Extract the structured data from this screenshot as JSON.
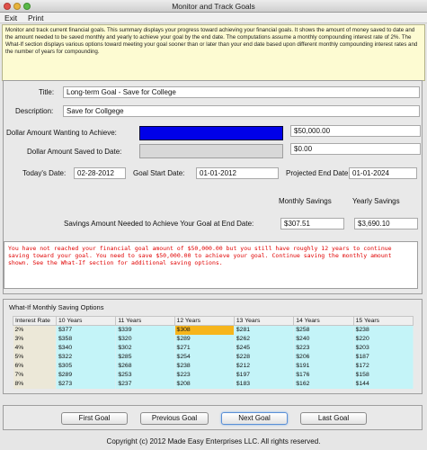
{
  "window": {
    "title": "Monitor and Track Goals"
  },
  "menu": {
    "exit": "Exit",
    "print": "Print"
  },
  "intro_text": "Monitor and track current financial goals. This summary displays your progress toward achieving your financial goals. It shows the amount of money saved to date and the amount needed to be saved monthly and yearly to achieve your goal by the end date. The computations assume a monthly compounding interest rate of 2%. The What-If section displays various options toward meeting your goal sooner than or later than your end date based upon different monthly compounding interest rates and the number of years for compounding.",
  "goal": {
    "title_label": "Title:",
    "title_value": "Long-term Goal - Save for College",
    "description_label": "Description:",
    "description_value": "Save for Collgege",
    "wanting_label": "Dollar Amount Wanting to Achieve:",
    "wanting_value": "$50,000.00",
    "saved_label": "Dollar Amount Saved to Date:",
    "saved_value": "$0.00",
    "saved_progress_percent": 0,
    "todays_date_label": "Today's Date:",
    "todays_date_value": "02-28-2012",
    "start_date_label": "Goal Start Date:",
    "start_date_value": "01-01-2012",
    "end_date_label": "Projected End Date:",
    "end_date_value": "01-01-2024",
    "monthly_header": "Monthly Savings",
    "yearly_header": "Yearly Savings",
    "needed_label": "Savings Amount Needed to Achieve Your Goal at End Date:",
    "monthly_value": "$307.51",
    "yearly_value": "$3,690.10"
  },
  "message": "You have not reached your financial goal amount of $50,000.00 but you still have roughly 12 years to continue saving toward your goal. You need to save $50,000.00 to achieve your goal. Continue saving the monthly amount shown. See the What-If section for additional saving options.",
  "whatif": {
    "title": "What-If Monthly Saving Options",
    "headers": [
      "Interest Rate",
      "10 Years",
      "11 Years",
      "12 Years",
      "13 Years",
      "14 Years",
      "15 Years"
    ],
    "rows": [
      [
        "2%",
        "$377",
        "$339",
        "$308",
        "$281",
        "$258",
        "$238"
      ],
      [
        "3%",
        "$358",
        "$320",
        "$289",
        "$262",
        "$240",
        "$220"
      ],
      [
        "4%",
        "$340",
        "$302",
        "$271",
        "$245",
        "$223",
        "$203"
      ],
      [
        "5%",
        "$322",
        "$285",
        "$254",
        "$228",
        "$206",
        "$187"
      ],
      [
        "6%",
        "$305",
        "$268",
        "$238",
        "$212",
        "$191",
        "$172"
      ],
      [
        "7%",
        "$289",
        "$253",
        "$223",
        "$197",
        "$176",
        "$158"
      ],
      [
        "8%",
        "$273",
        "$237",
        "$208",
        "$183",
        "$162",
        "$144"
      ]
    ],
    "highlighted_cell": {
      "row": 0,
      "col": 3
    }
  },
  "buttons": {
    "first": "First Goal",
    "previous": "Previous Goal",
    "next": "Next Goal",
    "last": "Last Goal"
  },
  "copyright": "Copyright (c) 2012 Made Easy Enterprises LLC. All rights reserved.",
  "colors": {
    "message_red": "#e00000",
    "wanting_bar_blue": "#0000e8",
    "table_cell_cyan": "#c4f4f8",
    "highlight_orange": "#f6b51c",
    "intro_yellow": "#fdfbd2"
  }
}
